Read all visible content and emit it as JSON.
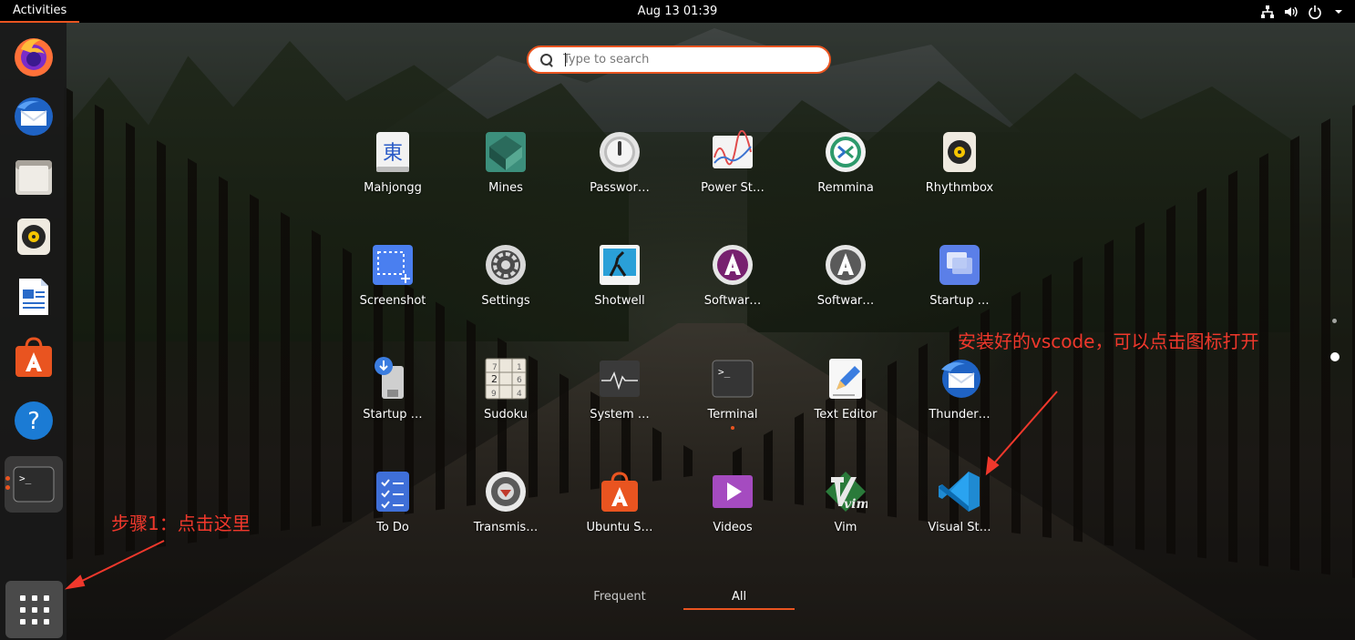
{
  "topbar": {
    "activities": "Activities",
    "clock": "Aug 13  01:39",
    "tray_icons": [
      "network-icon",
      "volume-icon",
      "power-icon",
      "chevron-down-icon"
    ]
  },
  "dock": {
    "items": [
      {
        "name": "Firefox",
        "icon": "firefox-icon"
      },
      {
        "name": "Thunderbird",
        "icon": "thunderbird-icon"
      },
      {
        "name": "Files",
        "icon": "files-icon"
      },
      {
        "name": "Rhythmbox",
        "icon": "rhythmbox-icon"
      },
      {
        "name": "LibreOffice Writer",
        "icon": "writer-icon"
      },
      {
        "name": "Ubuntu Software",
        "icon": "ubuntu-software-icon"
      },
      {
        "name": "Help",
        "icon": "help-icon"
      },
      {
        "name": "Terminal",
        "icon": "terminal-icon",
        "running": true
      }
    ],
    "show_apps_icon": "show-applications-icon"
  },
  "search": {
    "placeholder": "Type to search",
    "value": ""
  },
  "apps": [
    {
      "label": "Mahjongg"
    },
    {
      "label": "Mines"
    },
    {
      "label": "Passwor…"
    },
    {
      "label": "Power St…"
    },
    {
      "label": "Remmina"
    },
    {
      "label": "Rhythmbox"
    },
    {
      "label": "Screenshot"
    },
    {
      "label": "Settings"
    },
    {
      "label": "Shotwell"
    },
    {
      "label": "Softwar…"
    },
    {
      "label": "Softwar…"
    },
    {
      "label": "Startup …"
    },
    {
      "label": "Startup …"
    },
    {
      "label": "Sudoku"
    },
    {
      "label": "System …"
    },
    {
      "label": "Terminal"
    },
    {
      "label": "Text Editor"
    },
    {
      "label": "Thunder…"
    },
    {
      "label": "To Do"
    },
    {
      "label": "Transmis…"
    },
    {
      "label": "Ubuntu S…"
    },
    {
      "label": "Videos"
    },
    {
      "label": "Vim"
    },
    {
      "label": "Visual St…"
    }
  ],
  "tabs": {
    "frequent": "Frequent",
    "all": "All",
    "active": "All"
  },
  "annotations": {
    "step1": "步骤1：点击这里",
    "vscode": "安装好的vscode，可以点击图标打开"
  },
  "colors": {
    "accent": "#e95420",
    "annotation": "#f0382c",
    "topbar": "#000000"
  }
}
